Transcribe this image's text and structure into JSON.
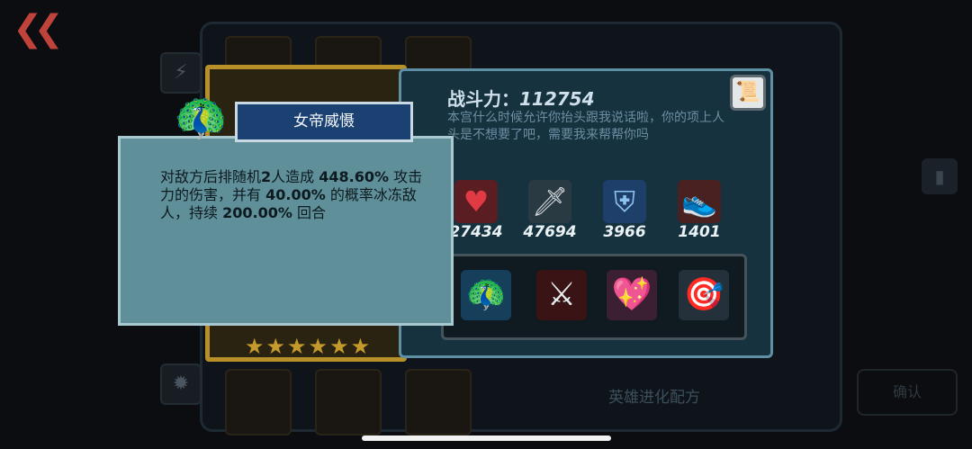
{
  "nav": {
    "back_icon": "double-chevron-left-icon"
  },
  "hero": {
    "power_label": "战斗力：",
    "power_value": "112754",
    "quote": "本宫什么时候允许你抬头跟我说话啦，你的项上人头是不想要了吧，需要我来帮帮你吗",
    "stars": [
      "★",
      "★",
      "★",
      "★",
      "★",
      "★"
    ]
  },
  "stats": [
    {
      "icon": "heart-icon",
      "value": "27434"
    },
    {
      "icon": "sword-icon",
      "value": "47694"
    },
    {
      "icon": "shield-icon",
      "value": "3966"
    },
    {
      "icon": "shoe-icon",
      "value": "1401"
    }
  ],
  "skills": [
    {
      "icon": "peacock-icon"
    },
    {
      "icon": "flaming-sword-icon"
    },
    {
      "icon": "winged-heart-icon"
    },
    {
      "icon": "crosshair-icon"
    }
  ],
  "tooltip": {
    "title": "女帝威慑",
    "desc_1": "对敌方后排随机",
    "desc_2": "2",
    "desc_3": "人造成 ",
    "desc_4": "448.60%",
    "desc_5": " 攻击力的伤害，并有 ",
    "desc_6": "40.00%",
    "desc_7": " 的概率冰冻敌人，持续 ",
    "desc_8": "200.00%",
    "desc_9": " 回合"
  },
  "background": {
    "recipe_label": "英雄进化配方",
    "right_button": "确认"
  },
  "colors": {
    "panel_bg": "#16323f",
    "tooltip_bg": "#5f8f98",
    "title_tab": "#1b4172",
    "gold": "#b8902a",
    "back_red": "#c0433b"
  }
}
